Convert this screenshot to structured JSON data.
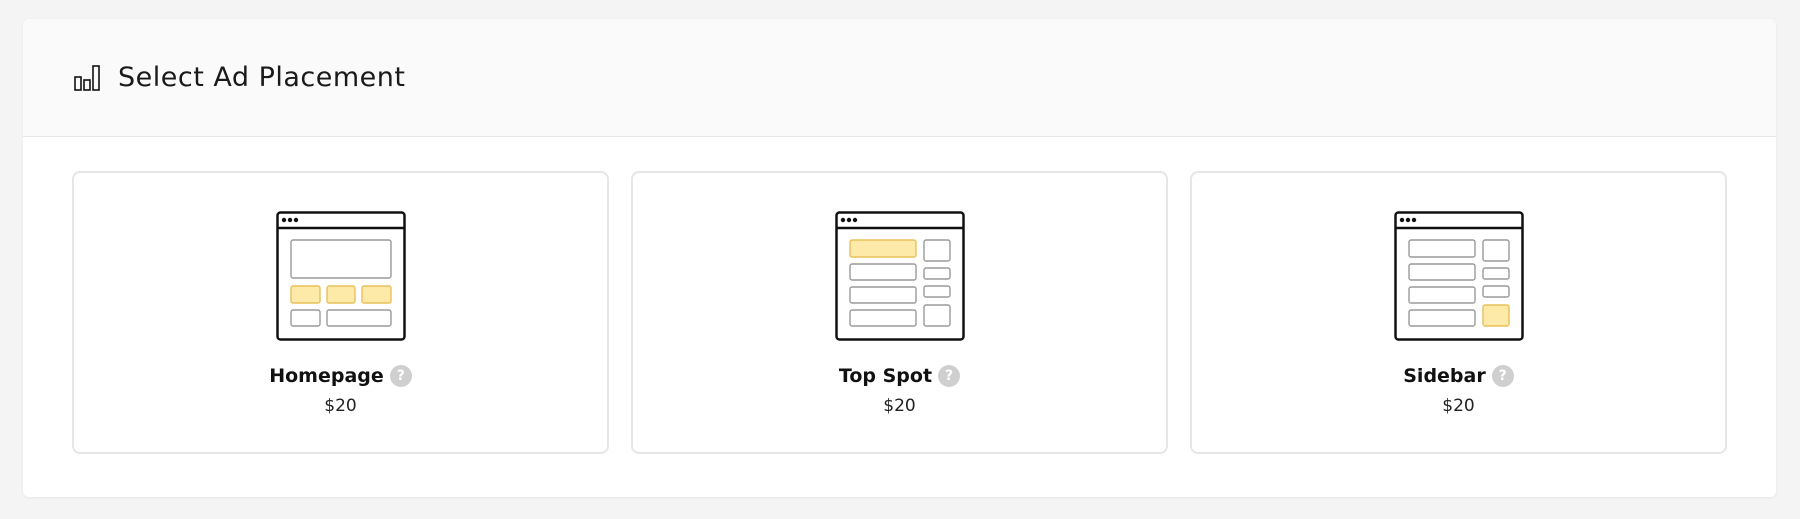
{
  "header": {
    "title": "Select Ad Placement",
    "icon": "bar-chart-icon"
  },
  "placements": [
    {
      "name": "Homepage",
      "price": "$20",
      "help_glyph": "?",
      "illustration": "homepage-layout-icon"
    },
    {
      "name": "Top Spot",
      "price": "$20",
      "help_glyph": "?",
      "illustration": "top-spot-layout-icon"
    },
    {
      "name": "Sidebar",
      "price": "$20",
      "help_glyph": "?",
      "illustration": "sidebar-layout-icon"
    }
  ],
  "colors": {
    "highlight_fill": "#fde9a8",
    "highlight_stroke": "#e9c05a",
    "outline": "#111111",
    "block_stroke": "#9a9a9a",
    "card_border": "#e6e6e6",
    "help_bg": "#cfcfcf"
  }
}
